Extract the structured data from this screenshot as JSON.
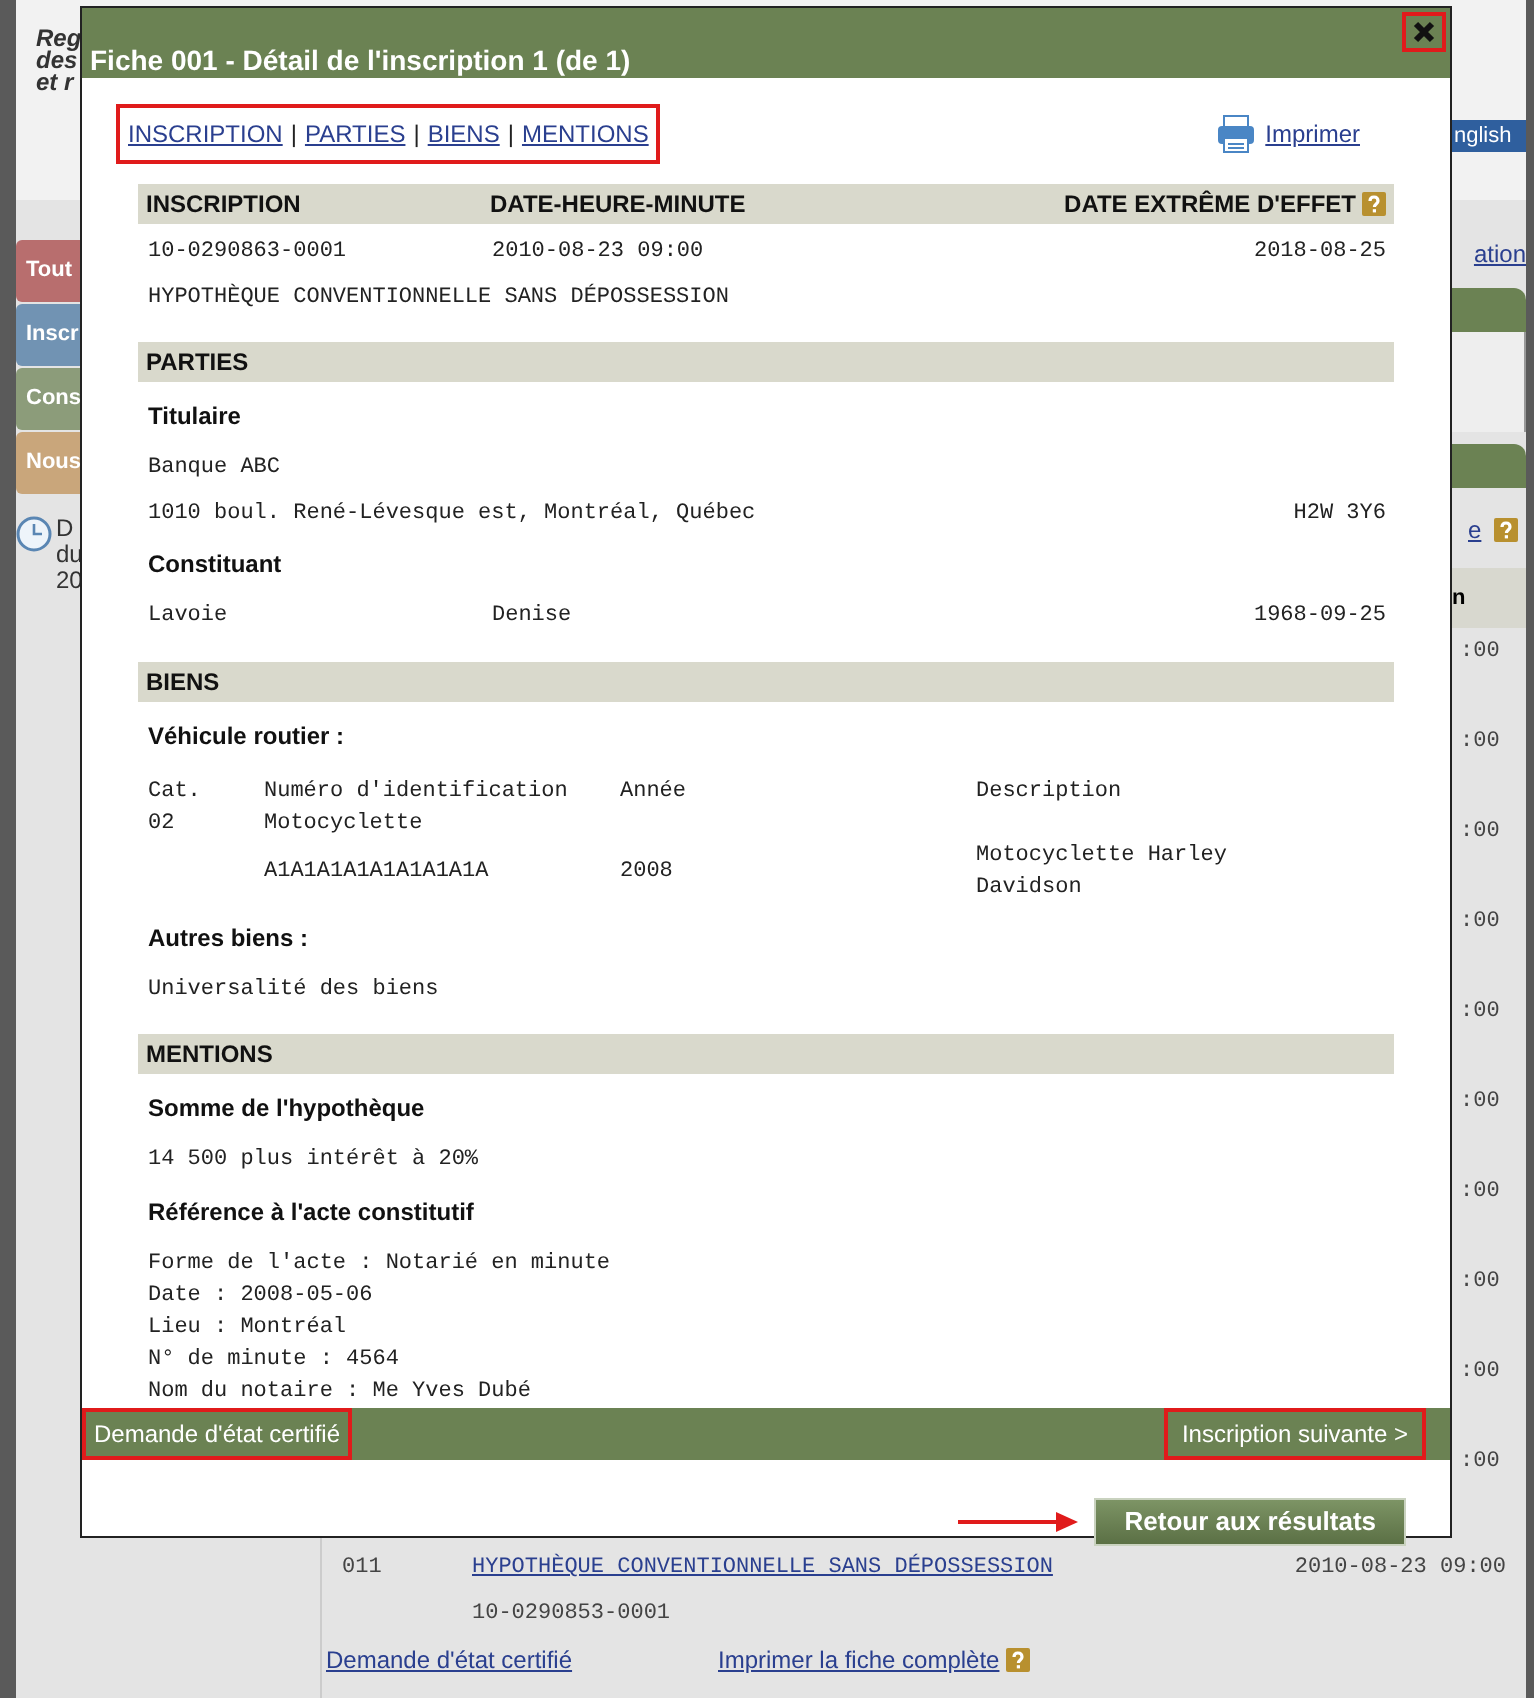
{
  "background_page": {
    "header_lines": [
      "Reg",
      "des",
      "et r"
    ],
    "language_link": "nglish",
    "side_tabs": [
      {
        "label": "Tout",
        "color": "#b86e6e"
      },
      {
        "label": "Inscr",
        "color": "#7193b3"
      },
      {
        "label": "Cons",
        "color": "#8c9c7a"
      },
      {
        "label": "Nous",
        "color": "#c9a67b"
      }
    ],
    "clock_text": [
      "D",
      "du",
      "20"
    ],
    "right_link": "ation",
    "right_help_link": "e",
    "column_header": "n",
    "time_fragments": [
      ":00",
      ":00",
      ":00",
      ":00",
      ":00",
      ":00",
      ":00",
      ":00",
      ":00",
      ":00"
    ],
    "last_row": {
      "number": "011",
      "type_link": "HYPOTHÈQUE CONVENTIONNELLE SANS DÉPOSSESSION",
      "datetime": "2010-08-23 09:00",
      "inscription": "10-0290853-0001"
    },
    "links": [
      "Demande d'état certifié",
      "Imprimer la fiche complète"
    ]
  },
  "dialog": {
    "title": "Fiche 001 - Détail de l'inscription 1 (de 1)",
    "close_highlighted": true,
    "nav": {
      "links": [
        "INSCRIPTION",
        "PARTIES",
        "BIENS",
        "MENTIONS"
      ],
      "separator": "|",
      "highlighted": true
    },
    "print_link": "Imprimer",
    "sections": [
      {
        "kind": "summary",
        "columns": [
          "INSCRIPTION",
          "DATE-HEURE-MINUTE",
          "DATE EXTRÊME D'EFFET"
        ],
        "blocks": [
          {
            "kind": "line",
            "cells": [
              "10-0290863-0001",
              "2010-08-23 09:00",
              "2018-08-25"
            ]
          },
          {
            "kind": "line",
            "cells": [
              "HYPOTHÈQUE CONVENTIONNELLE SANS DÉPOSSESSION"
            ]
          }
        ]
      },
      {
        "kind": "titled",
        "title": "PARTIES",
        "blocks": [
          {
            "kind": "subheading",
            "text": "Titulaire"
          },
          {
            "kind": "line",
            "cells": [
              "Banque ABC"
            ]
          },
          {
            "kind": "line",
            "cells": [
              "1010 boul. René-Lévesque est, Montréal, Québec",
              "H2W 3Y6"
            ]
          },
          {
            "kind": "subheading",
            "text": "Constituant"
          },
          {
            "kind": "line",
            "cells": [
              "Lavoie",
              "Denise",
              "1968-09-25"
            ]
          }
        ]
      },
      {
        "kind": "titled",
        "title": "BIENS",
        "blocks": [
          {
            "kind": "subheading",
            "text": "Véhicule routier :"
          },
          {
            "kind": "table",
            "columns": [
              "Cat.",
              "Numéro d'identification",
              "Année",
              "Description"
            ],
            "rows": [
              [
                "02",
                "Motocyclette",
                "",
                ""
              ],
              [
                "",
                "A1A1A1A1A1A1A1A1A",
                "2008",
                "Motocyclette Harley Davidson"
              ]
            ]
          },
          {
            "kind": "subheading",
            "text": "Autres biens :"
          },
          {
            "kind": "line",
            "cells": [
              "Universalité des biens"
            ]
          }
        ]
      },
      {
        "kind": "titled",
        "title": "MENTIONS",
        "blocks": [
          {
            "kind": "subheading",
            "text": "Somme de l'hypothèque"
          },
          {
            "kind": "line",
            "cells": [
              "14 500 plus intérêt à 20%"
            ]
          },
          {
            "kind": "subheading",
            "text": "Référence à l'acte constitutif"
          },
          {
            "kind": "lines",
            "lines": [
              "Forme de l'acte : Notarié en minute",
              "Date : 2008-05-06",
              "Lieu : Montréal",
              "N° de minute : 4564",
              "Nom du notaire : Me Yves Dubé"
            ]
          }
        ]
      }
    ],
    "footer": {
      "certificate_link": "Demande d'état certifié",
      "certificate_highlighted": true,
      "next_link": "Inscription suivante >",
      "next_highlighted": true
    },
    "back_button": "Retour aux résultats"
  }
}
